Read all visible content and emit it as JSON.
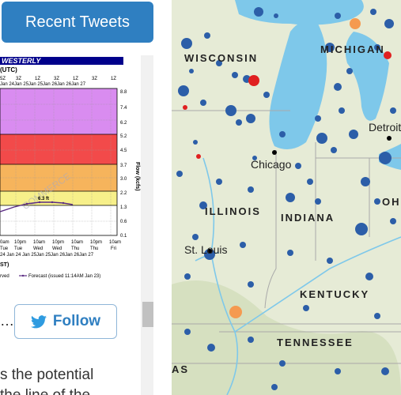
{
  "sidebar": {
    "recent_tweets_label": "Recent Tweets",
    "follow_label": "Follow",
    "ellipsis": "…",
    "tweet_line1": "s the potential",
    "tweet_line2": "  the  line  of the"
  },
  "hydrograph": {
    "title": "WESTERLY",
    "utc_label": "(UTC)",
    "top_times": [
      "Z",
      "3Z",
      "1Z",
      "3Z",
      "1Z",
      "3Z",
      "1Z"
    ],
    "top_dates": [
      "Jan 24",
      "Jan 25",
      "Jan 25",
      "Jan 26",
      "Jan 26",
      "Jan 27"
    ],
    "y_ticks": [
      "8.8",
      "7.4",
      "6.2",
      "5.2",
      "4.5",
      "3.7",
      "3.0",
      "2.2",
      "1.9",
      "1.3",
      "0.6",
      "0.1"
    ],
    "y_axis_label": "Flow (kcfs)",
    "peak_label": "6.3 ft",
    "bottom_times": [
      "0am",
      "10pm",
      "10am",
      "10pm",
      "10am",
      "10pm",
      "10am"
    ],
    "bottom_days": [
      "Tue",
      "Wed",
      "Wed",
      "Thu",
      "Thu",
      "Fri"
    ],
    "bottom_dates": [
      "24 Jan 24",
      "Jan 25",
      "Jan 25",
      "Jan 26",
      "Jan 26",
      "Jan 27"
    ],
    "tz_label": "ST)",
    "legend_observed": "rved",
    "legend_forecast": "Forecast (issued 11:14AM Jan 23)",
    "colors": {
      "purple": "#d98cf0",
      "red": "#f24a4a",
      "orange": "#f6b45c",
      "yellow": "#f7f08a"
    }
  },
  "map": {
    "states": [
      "WISCONSIN",
      "MICHIGAN",
      "ILLINOIS",
      "INDIANA",
      "OHIO",
      "KENTUCKY",
      "TENNESSEE",
      "AS"
    ],
    "cities": [
      "Chicago",
      "St. Louis",
      "Detroit"
    ],
    "marker_colors": {
      "normal": "#2c5ea8",
      "flood": "#e02020",
      "action": "#f59a50",
      "lake": "#7ec8ea"
    }
  }
}
